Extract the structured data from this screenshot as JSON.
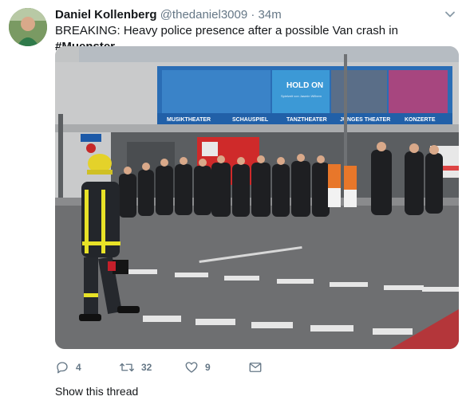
{
  "tweet": {
    "author_name": "Daniel Kollenberg",
    "author_handle": "@thedaniel3009",
    "separator": "·",
    "time": "34m",
    "text_prefix": "BREAKING: Heavy police presence after a possible Van crash in ",
    "hashtag": "#Muenster"
  },
  "photo": {
    "banner_text": "HOLD ON",
    "banner_subtext": "Spielzeit von Jasmin Wilhem",
    "theater_labels": [
      "MUSIKTHEATER",
      "SCHAUSPIEL",
      "TANZTHEATER",
      "JUNGES THEATER",
      "KONZERTE"
    ],
    "sign_text": "mt"
  },
  "actions": {
    "replies": "4",
    "retweets": "32",
    "likes": "9"
  },
  "show_thread": "Show this thread",
  "icons": [
    "avatar",
    "chevron-down-icon",
    "reply-icon",
    "retweet-icon",
    "like-icon",
    "message-icon"
  ]
}
